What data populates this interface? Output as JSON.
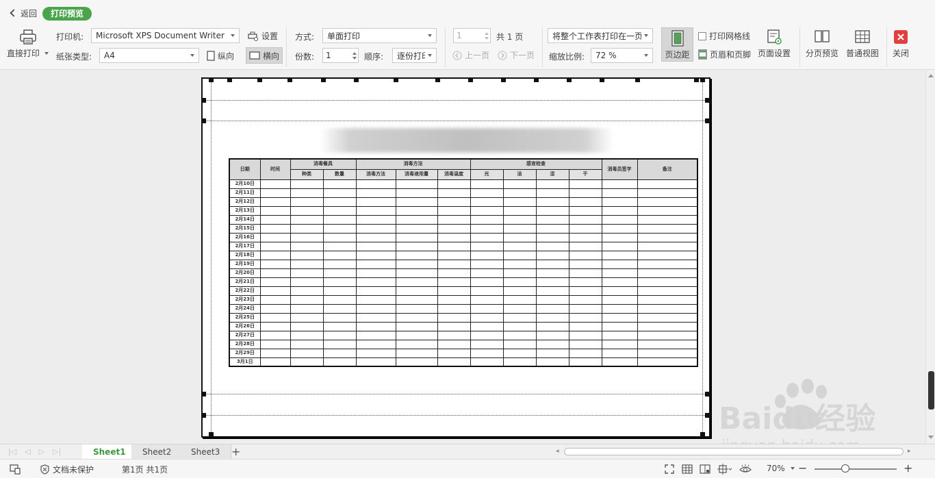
{
  "toolbar": {
    "back_label": "返回",
    "mode_pill": "打印预览",
    "direct_print": "直接打印",
    "printer_label": "打印机:",
    "printer_value": "Microsoft XPS Document Writer",
    "settings": "设置",
    "paper_label": "纸张类型:",
    "paper_value": "A4",
    "portrait": "纵向",
    "landscape": "横向",
    "method_label": "方式:",
    "method_value": "单面打印",
    "copies_label": "份数:",
    "copies_value": "1",
    "order_label": "顺序:",
    "order_value": "逐份打印",
    "page_input": "1",
    "total_pages": "共 1 页",
    "prev_page": "上一页",
    "next_page": "下一页",
    "fit_value": "将整个工作表打印在一页",
    "scale_label": "缩放比例:",
    "scale_value": "72 %",
    "margins": "页边距",
    "print_grid": "打印网格线",
    "header_footer": "页眉和页脚",
    "page_setup": "页面设置",
    "page_break_preview": "分页预览",
    "normal_view": "普通视图",
    "close": "关闭"
  },
  "sheet_table": {
    "header_row1": [
      "日期",
      "时间",
      "消毒餐具",
      "消毒方法",
      "感官检查",
      "消毒员签字",
      "备注"
    ],
    "header_row2": [
      "种类",
      "数量",
      "消毒方法",
      "消毒液用量",
      "消毒温度",
      "光",
      "洁",
      "涩",
      "干"
    ],
    "dates": [
      "2月10日",
      "2月11日",
      "2月12日",
      "2月13日",
      "2月14日",
      "2月15日",
      "2月16日",
      "2月17日",
      "2月18日",
      "2月19日",
      "2月20日",
      "2月21日",
      "2月22日",
      "2月23日",
      "2月24日",
      "2月25日",
      "2月26日",
      "2月27日",
      "2月28日",
      "2月29日",
      "3月1日"
    ]
  },
  "tabs": {
    "sheet1": "Sheet1",
    "sheet2": "Sheet2",
    "sheet3": "Sheet3"
  },
  "status": {
    "protection": "文档未保护",
    "page_info": "第1页 共1页",
    "zoom": "70%"
  },
  "watermark": {
    "brand": "Baidu经验",
    "url": "jingyan.baidu.com"
  },
  "colors": {
    "accent_green": "#4aa44c",
    "close_red": "#e04040"
  }
}
